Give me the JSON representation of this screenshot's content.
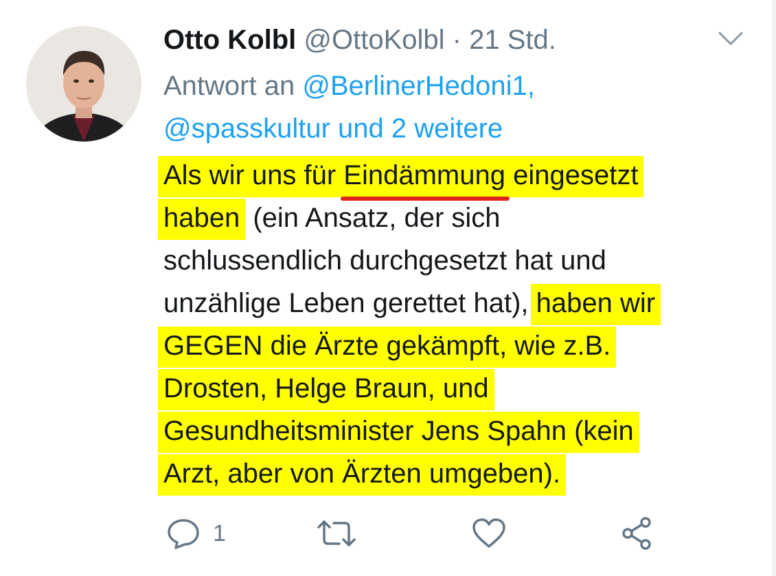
{
  "tweet": {
    "display_name": "Otto Kolbl",
    "handle": "@OttoKolbl",
    "separator": "·",
    "time": "21 Std.",
    "reply_prefix": "Antwort an",
    "reply_mention_1": "@BerlinerHedoni1,",
    "reply_mention_2": "@spasskultur und 2 weitere",
    "body": {
      "l1_a": "Als wir uns für ",
      "l1_b": "Eindämmung",
      "l1_c": " eingesetzt",
      "l2_a": "haben",
      "l2_b": " (ein Ansatz, der sich",
      "l3": "schlussendlich durchgesetzt hat und",
      "l4_a": "unzählige Leben gerettet hat), ",
      "l4_b": "haben wir",
      "l5": "GEGEN die Ärzte gekämpft, wie z.B.",
      "l6": "Drosten, Helge Braun, und",
      "l7": "Gesundheitsminister Jens Spahn (kein",
      "l8": "Arzt, aber von Ärzten umgeben)."
    },
    "actions": {
      "reply_count": "1"
    }
  },
  "icons": {
    "caret": "chevron-down-icon",
    "reply": "reply-icon",
    "retweet": "retweet-icon",
    "like": "heart-icon",
    "share": "share-icon"
  },
  "colors": {
    "highlight": "#ffff00",
    "underline": "#e2231a",
    "link": "#1da1f2",
    "secondary_text": "#657786",
    "primary_text": "#14171a"
  }
}
